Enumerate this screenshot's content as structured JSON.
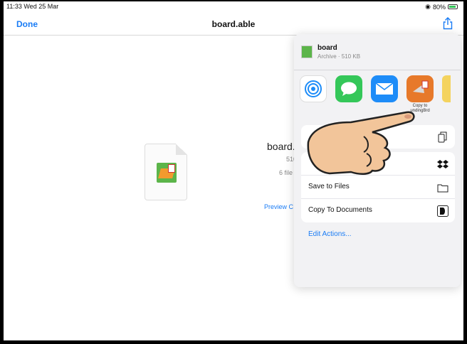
{
  "statusbar": {
    "time": "11:33  Wed 25 Mar",
    "battery": "80%"
  },
  "nav": {
    "done": "Done",
    "title": "board.able"
  },
  "file": {
    "name": "board.",
    "size": "510 K",
    "files": "6 file",
    "preview": "Preview C"
  },
  "sheet": {
    "name": "board",
    "meta": "Archive · 510 KB",
    "apps": [
      {
        "label": ""
      },
      {
        "label": ""
      },
      {
        "label": ""
      },
      {
        "label": "Copy to\nundingBrd"
      }
    ],
    "actions_group1": [
      {
        "label": ""
      }
    ],
    "actions_group2": [
      {
        "label": ""
      },
      {
        "label": "Save to Files"
      },
      {
        "label": "Copy To Documents"
      }
    ],
    "edit_actions": "Edit Actions..."
  }
}
